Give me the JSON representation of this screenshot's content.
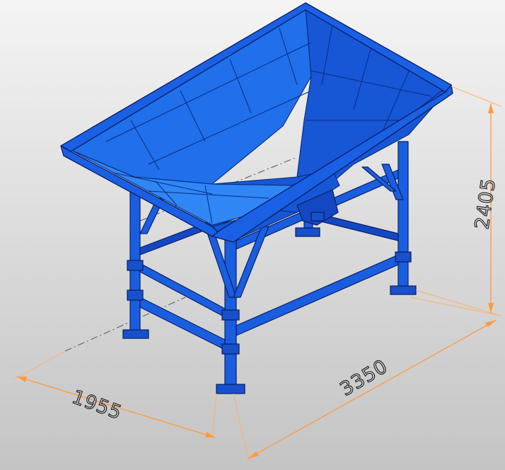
{
  "dimensions": {
    "width_label": "1955",
    "length_label": "3350",
    "height_label": "2405"
  },
  "colors": {
    "steel": "#1a5ee0",
    "dimension_line": "#ff9a3c",
    "background": "#d9d9d9"
  }
}
